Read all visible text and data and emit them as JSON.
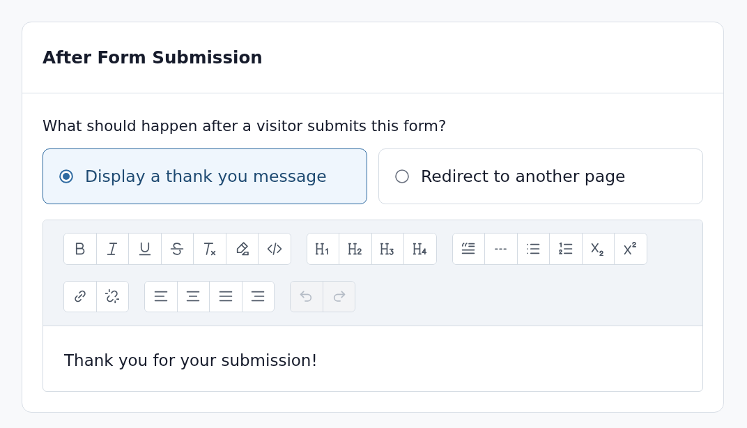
{
  "card": {
    "title": "After Form Submission"
  },
  "question": "What should happen after a visitor submits this form?",
  "options": [
    {
      "label": "Display a thank you message",
      "selected": true
    },
    {
      "label": "Redirect to another page",
      "selected": false
    }
  ],
  "editor": {
    "toolbar_rows": [
      {
        "groups": [
          {
            "buttons": [
              {
                "kind": "bold",
                "disabled": false
              },
              {
                "kind": "italic",
                "disabled": false
              },
              {
                "kind": "underline",
                "disabled": false
              },
              {
                "kind": "strike",
                "disabled": false
              },
              {
                "kind": "clear",
                "disabled": false
              },
              {
                "kind": "highlight",
                "disabled": false
              },
              {
                "kind": "code",
                "disabled": false
              }
            ]
          },
          {
            "buttons": [
              {
                "kind": "h1",
                "disabled": false
              },
              {
                "kind": "h2",
                "disabled": false
              },
              {
                "kind": "h3",
                "disabled": false
              },
              {
                "kind": "h4",
                "disabled": false
              }
            ]
          },
          {
            "buttons": [
              {
                "kind": "quote",
                "disabled": false
              },
              {
                "kind": "rule",
                "disabled": false
              },
              {
                "kind": "bullets",
                "disabled": false
              },
              {
                "kind": "numbers",
                "disabled": false
              },
              {
                "kind": "subscript",
                "disabled": false
              },
              {
                "kind": "superscript",
                "disabled": false
              }
            ]
          }
        ]
      },
      {
        "groups": [
          {
            "buttons": [
              {
                "kind": "link",
                "disabled": false
              },
              {
                "kind": "unlink",
                "disabled": false
              }
            ]
          },
          {
            "buttons": [
              {
                "kind": "left",
                "disabled": false
              },
              {
                "kind": "center",
                "disabled": false
              },
              {
                "kind": "justify",
                "disabled": false
              },
              {
                "kind": "right",
                "disabled": false
              }
            ]
          },
          {
            "buttons": [
              {
                "kind": "undo",
                "disabled": true
              },
              {
                "kind": "redo",
                "disabled": true
              }
            ]
          }
        ]
      }
    ],
    "content": "Thank you for your submission!"
  }
}
